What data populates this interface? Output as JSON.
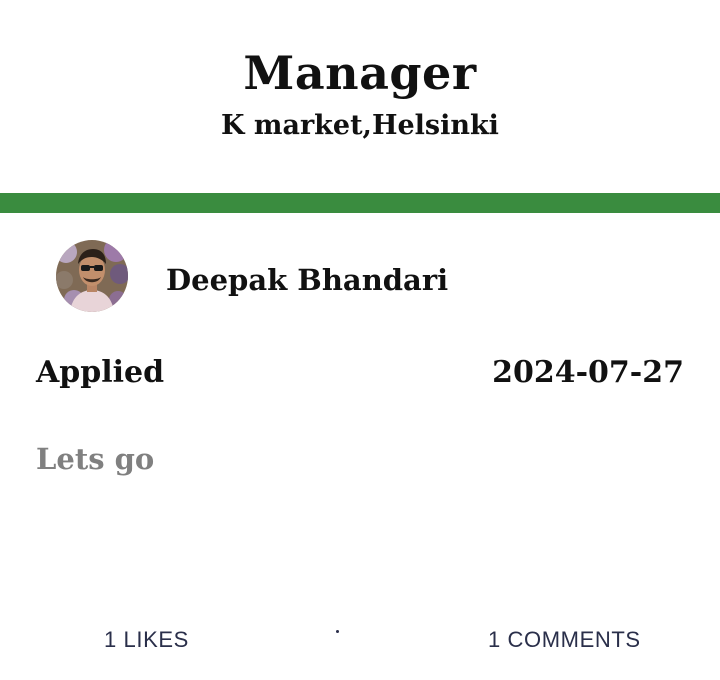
{
  "job": {
    "title": "Manager",
    "location": "K market,Helsinki"
  },
  "applicant": {
    "name": "Deepak Bhandari",
    "avatar_icon": "user-avatar-photo"
  },
  "application": {
    "status": "Applied",
    "date": "2024-07-27",
    "message": "Lets go"
  },
  "footer": {
    "likes_label": "1 LIKES",
    "comments_label": "1 COMMENTS"
  },
  "colors": {
    "divider": "#3a8c3f",
    "primary_text": "#111111",
    "muted_text": "#808080",
    "footer_text": "#2a2f4a"
  }
}
